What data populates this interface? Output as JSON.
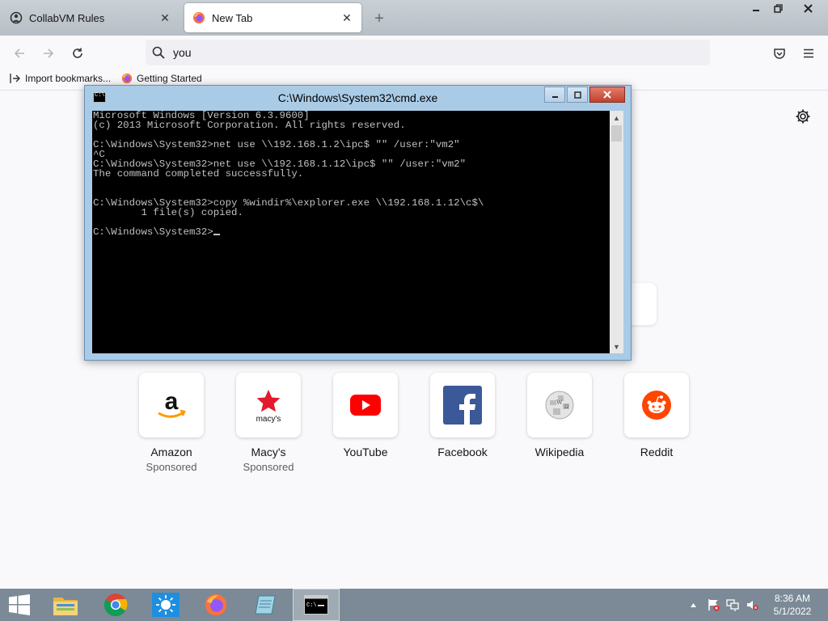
{
  "browser": {
    "tabs": [
      {
        "label": "CollabVM Rules",
        "icon": "collabvm-icon",
        "active": false
      },
      {
        "label": "New Tab",
        "icon": "firefox-icon",
        "active": true
      }
    ],
    "new_tab_symbol": "+",
    "window_controls": [
      "minimize",
      "restore",
      "close"
    ],
    "url_value": "you",
    "bookmarks": [
      {
        "label": "Import bookmarks...",
        "icon": "import-icon"
      },
      {
        "label": "Getting Started",
        "icon": "firefox-icon"
      }
    ]
  },
  "top_sites": [
    {
      "name": "Amazon",
      "sponsored": "Sponsored",
      "icon": "amazon-icon"
    },
    {
      "name": "Macy's",
      "sponsored": "Sponsored",
      "icon": "macys-icon",
      "logo_text": "macy's"
    },
    {
      "name": "YouTube",
      "sponsored": "",
      "icon": "youtube-icon"
    },
    {
      "name": "Facebook",
      "sponsored": "",
      "icon": "facebook-icon"
    },
    {
      "name": "Wikipedia",
      "sponsored": "",
      "icon": "wikipedia-icon"
    },
    {
      "name": "Reddit",
      "sponsored": "",
      "icon": "reddit-icon"
    }
  ],
  "cmd": {
    "title": "C:\\Windows\\System32\\cmd.exe",
    "lines": [
      "Microsoft Windows [Version 6.3.9600]",
      "(c) 2013 Microsoft Corporation. All rights reserved.",
      "",
      "C:\\Windows\\System32>net use \\\\192.168.1.2\\ipc$ \"\" /user:\"vm2\"",
      "^C",
      "C:\\Windows\\System32>net use \\\\192.168.1.12\\ipc$ \"\" /user:\"vm2\"",
      "The command completed successfully.",
      "",
      "",
      "C:\\Windows\\System32>copy %windir%\\explorer.exe \\\\192.168.1.12\\c$\\",
      "        1 file(s) copied.",
      "",
      "C:\\Windows\\System32>"
    ]
  },
  "taskbar": {
    "apps": [
      "file-explorer-icon",
      "chrome-icon",
      "weather-icon",
      "firefox-icon",
      "notepad-icon",
      "cmd-icon"
    ],
    "clock_time": "8:36 AM",
    "clock_date": "5/1/2022"
  },
  "colors": {
    "cmd_frame": "#a9cbe6",
    "console_bg": "#000000",
    "console_text": "#c0c0c0",
    "taskbar": "#7b8a96",
    "amazon_orange": "#ff9900",
    "macys_red": "#e21a2c",
    "youtube_red": "#ff0000",
    "facebook_blue": "#3b5998",
    "reddit_orange": "#ff4500"
  }
}
